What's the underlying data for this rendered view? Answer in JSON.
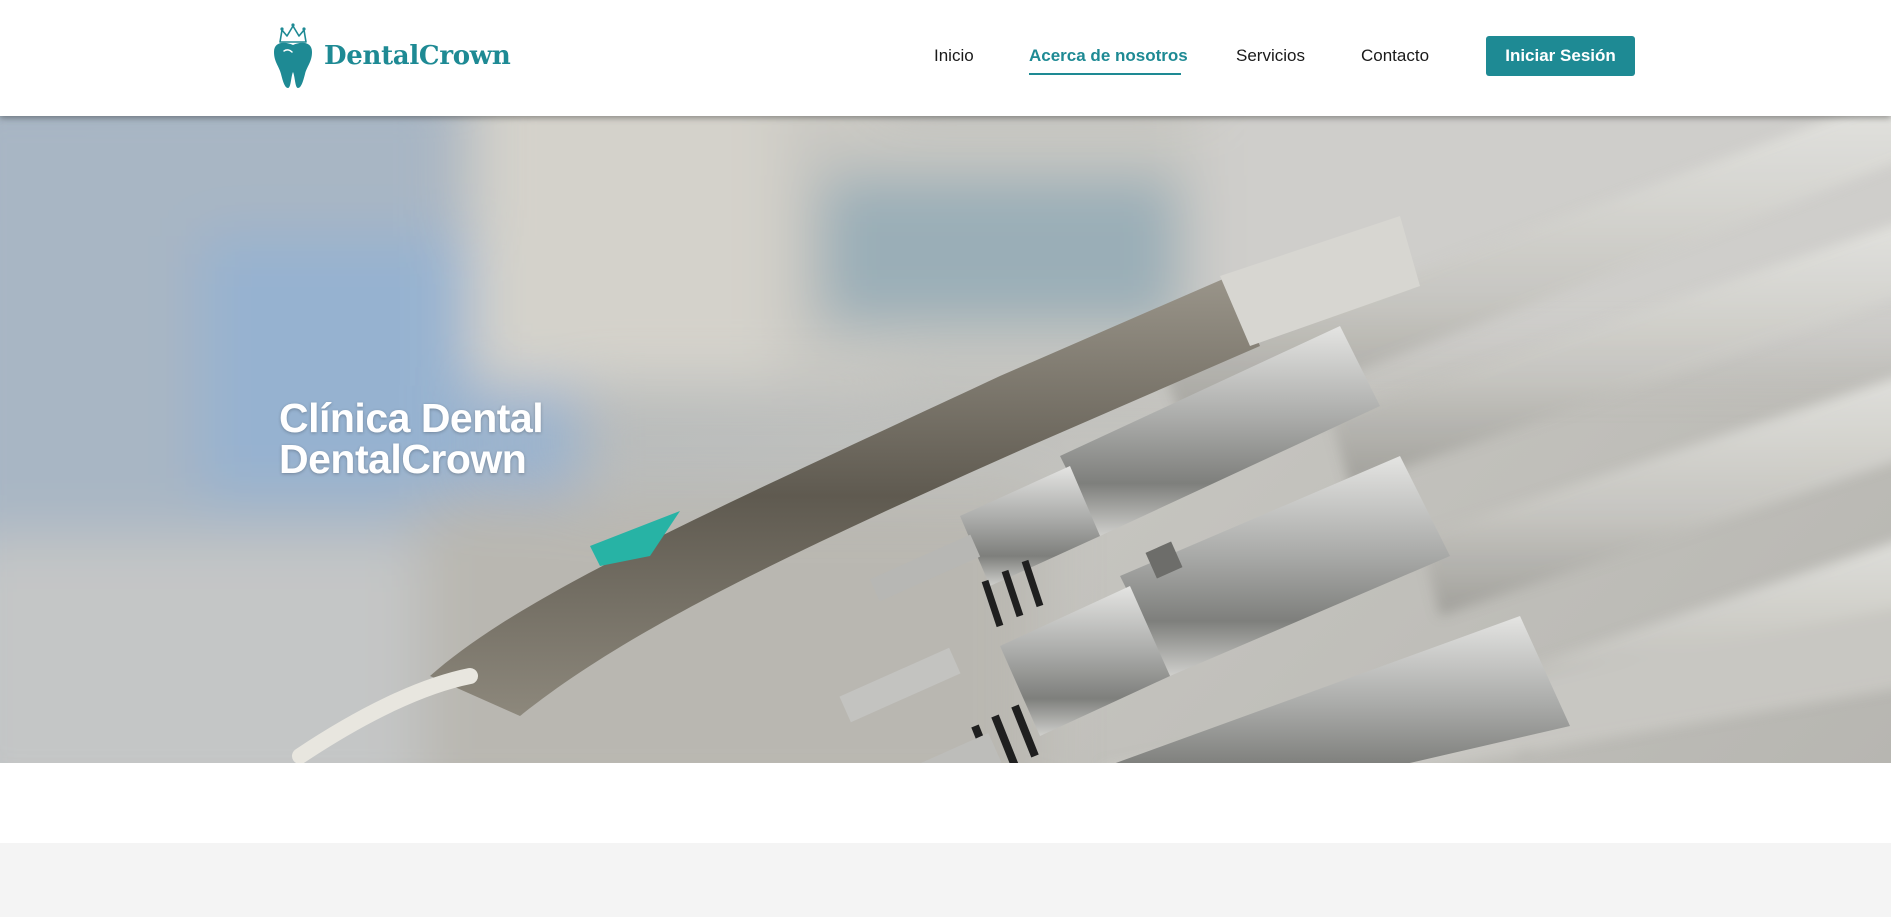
{
  "brand": {
    "name": "DentalCrown",
    "color": "#1e8a94",
    "logo_icon": "tooth-crown-icon"
  },
  "nav": {
    "items": [
      {
        "label": "Inicio",
        "active": false
      },
      {
        "label": "Acerca de nosotros",
        "active": true
      },
      {
        "label": "Servicios",
        "active": false
      },
      {
        "label": "Contacto",
        "active": false
      }
    ],
    "login_label": "Iniciar Sesión"
  },
  "hero": {
    "title_line1": "Clínica Dental",
    "title_line2": "DentalCrown",
    "image_subject": "dental handpieces on a dental unit"
  }
}
